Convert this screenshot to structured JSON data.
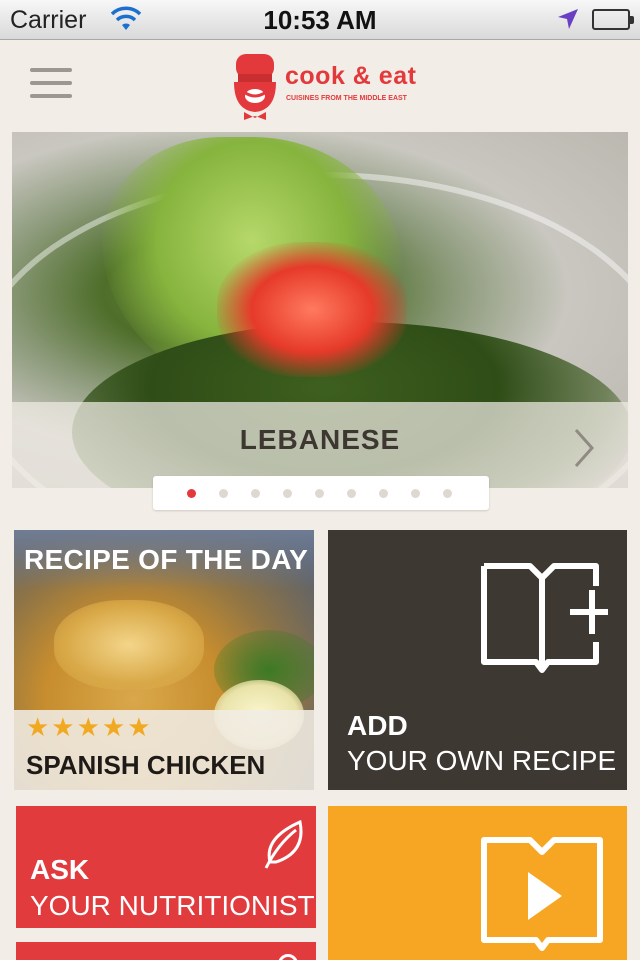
{
  "status_bar": {
    "carrier": "Carrier",
    "time": "10:53 AM",
    "icons": [
      "wifi-icon",
      "location-arrow-icon",
      "battery-icon"
    ]
  },
  "header": {
    "menu_icon": "hamburger-menu-icon",
    "logo_name": "cook & eat",
    "logo_tagline": "CUISINES FROM THE MIDDLE EAST"
  },
  "carousel": {
    "caption": "LEBANESE",
    "next_icon": "chevron-right-icon",
    "page_count": 9,
    "active_page": 1
  },
  "tiles": {
    "recipe_of_day": {
      "title": "RECIPE OF THE DAY",
      "stars": "★★★★★",
      "rating": 5,
      "name": "SPANISH CHICKEN"
    },
    "add_recipe": {
      "icon": "book-plus-icon",
      "line1": "ADD",
      "line2": "YOUR OWN RECIPE"
    },
    "ask_nutritionist": {
      "icon": "leaf-icon",
      "line1": "ASK",
      "line2": "YOUR NUTRITIONIST"
    },
    "video": {
      "icon": "book-play-icon"
    }
  },
  "colors": {
    "brand_red": "#e3393c",
    "dark_tile": "#3e3833",
    "orange_tile": "#f7a623",
    "background": "#f2ede6",
    "star": "#f2a922"
  }
}
